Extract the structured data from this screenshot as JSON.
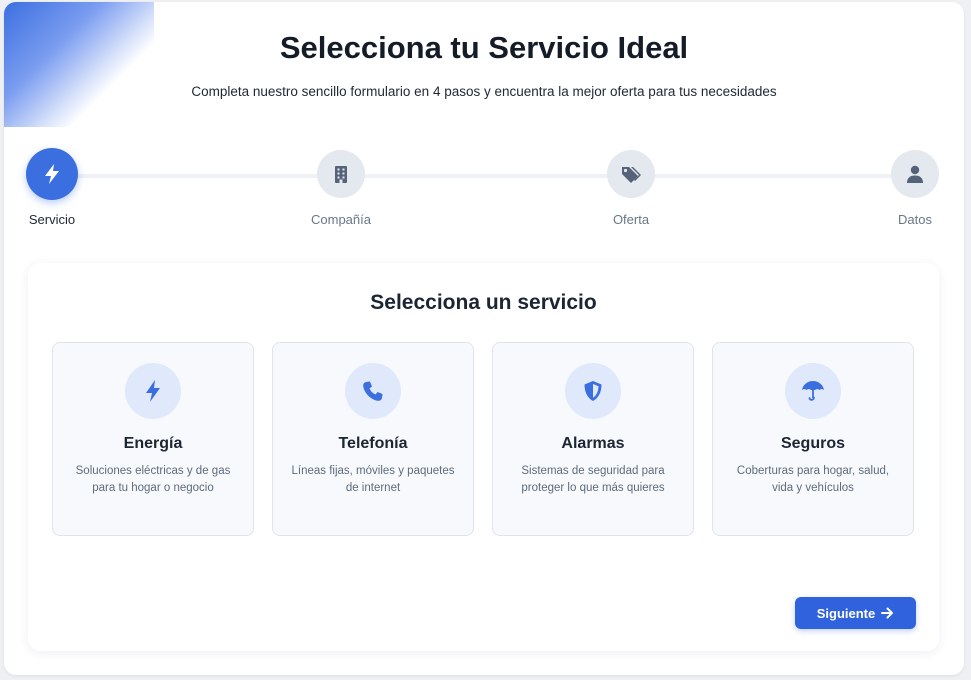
{
  "header": {
    "title": "Selecciona tu Servicio Ideal",
    "subtitle": "Completa nuestro sencillo formulario en 4 pasos y encuentra la mejor oferta para tus necesidades"
  },
  "steps": [
    {
      "label": "Servicio",
      "icon": "bolt-icon",
      "active": true
    },
    {
      "label": "Compañía",
      "icon": "building-icon",
      "active": false
    },
    {
      "label": "Oferta",
      "icon": "tags-icon",
      "active": false
    },
    {
      "label": "Datos",
      "icon": "user-icon",
      "active": false
    }
  ],
  "main": {
    "title": "Selecciona un servicio",
    "services": [
      {
        "name": "Energía",
        "description": "Soluciones eléctricas y de gas para tu hogar o negocio",
        "icon": "bolt-icon"
      },
      {
        "name": "Telefonía",
        "description": "Líneas fijas, móviles y paquetes de internet",
        "icon": "phone-icon"
      },
      {
        "name": "Alarmas",
        "description": "Sistemas de seguridad para proteger lo que más quieres",
        "icon": "shield-icon"
      },
      {
        "name": "Seguros",
        "description": "Coberturas para hogar, salud, vida y vehículos",
        "icon": "umbrella-icon"
      }
    ],
    "next_label": "Siguiente"
  },
  "colors": {
    "accent": "#3b6fe0",
    "button": "#2f62dc",
    "inactive_step": "#e4e8ef",
    "icon_bg": "#dfe9fb"
  }
}
